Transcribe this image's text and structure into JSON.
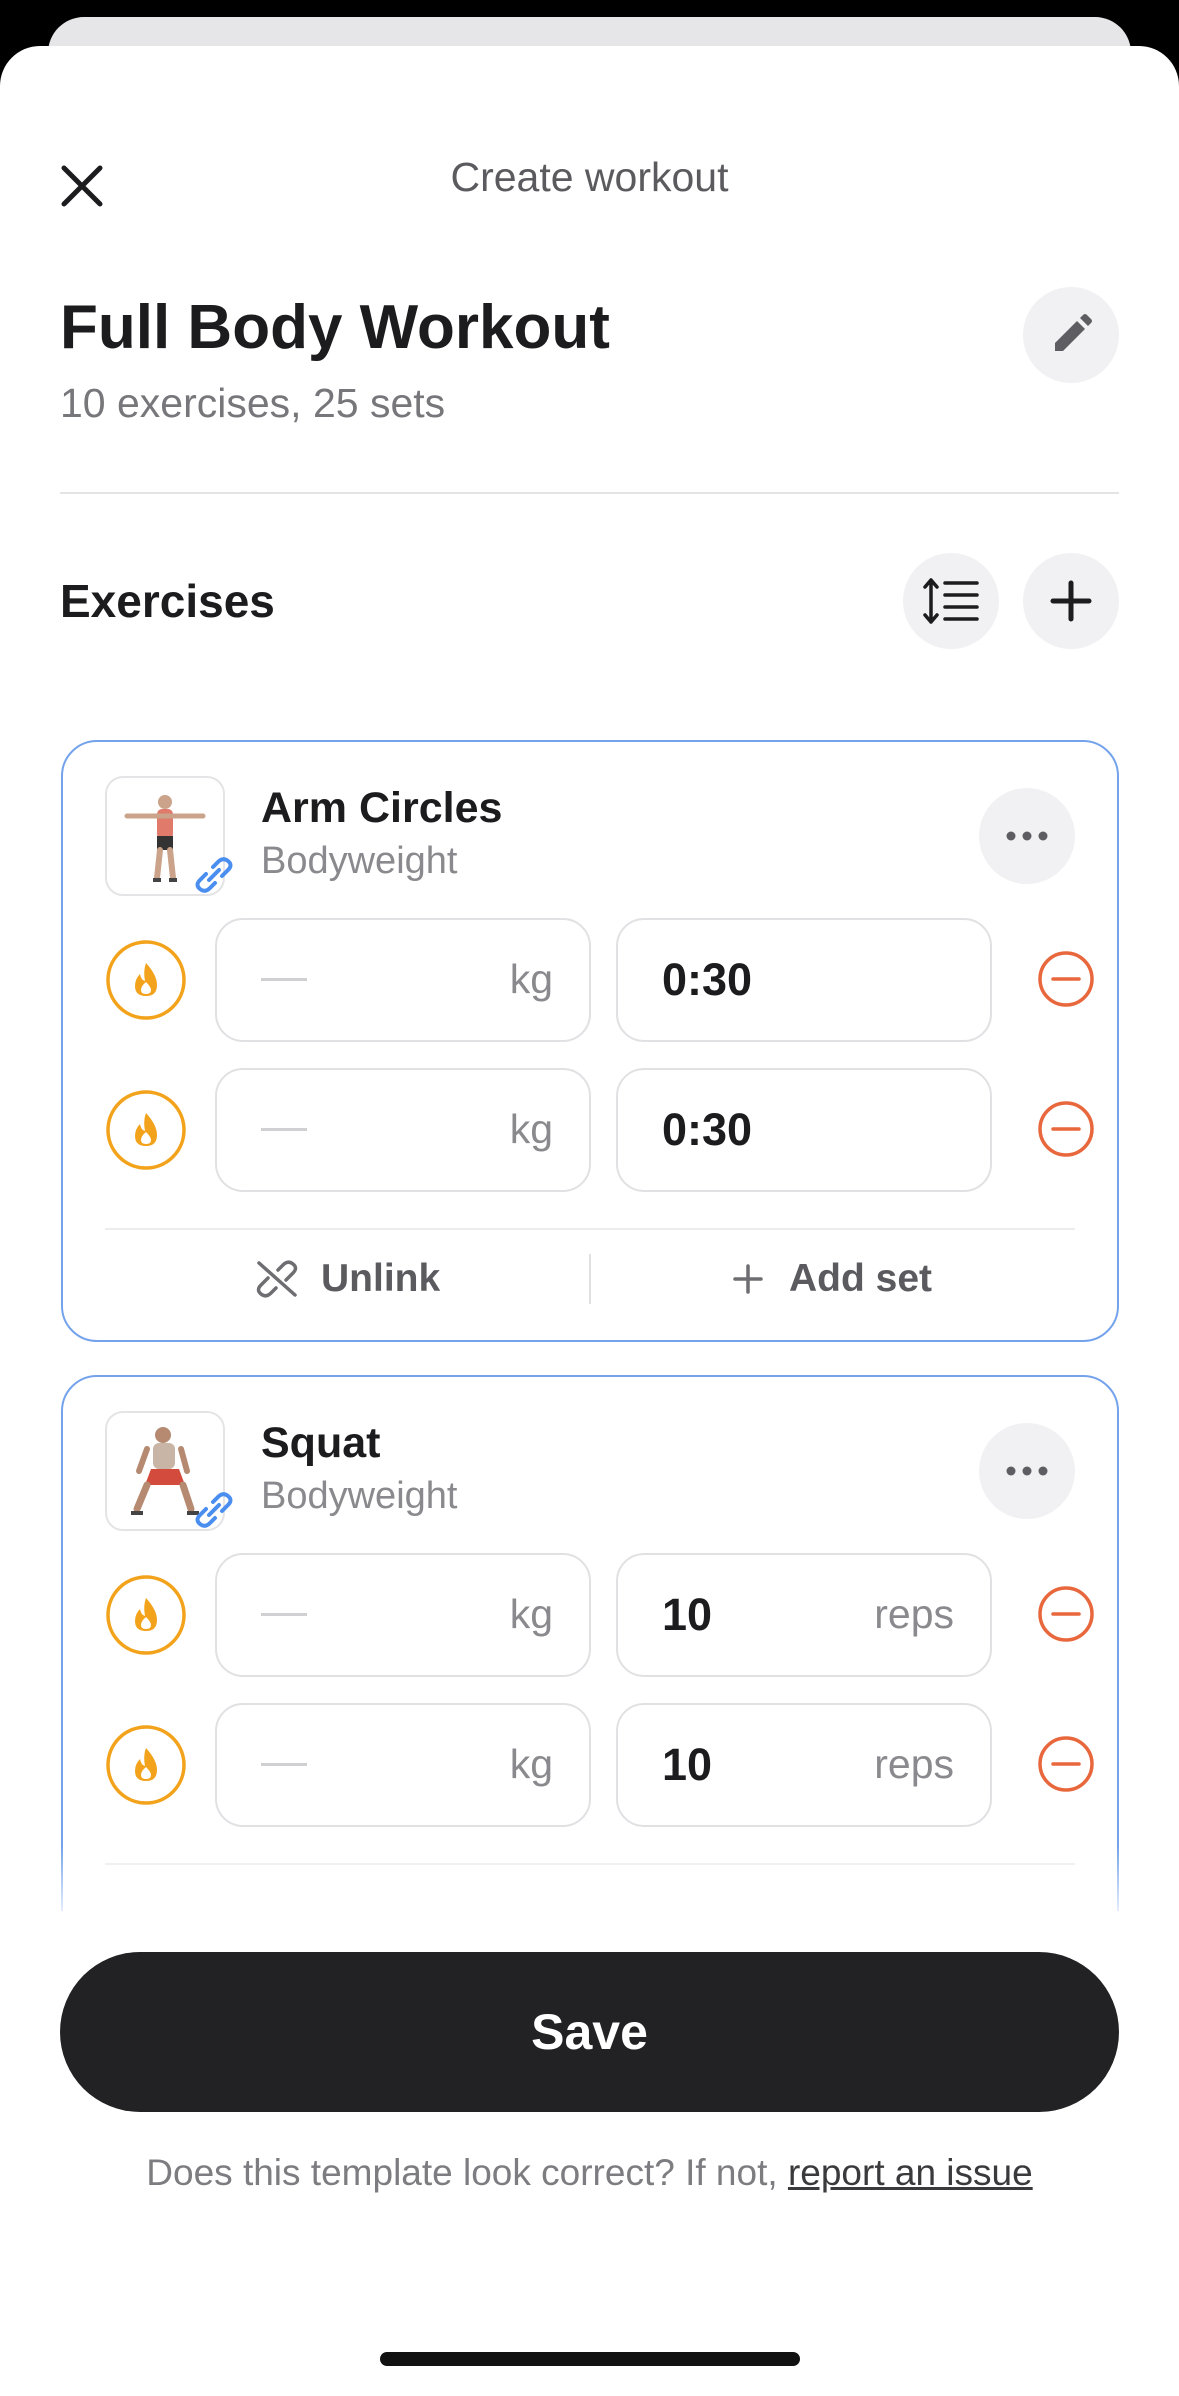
{
  "header": {
    "title": "Create workout"
  },
  "workout": {
    "name": "Full Body Workout",
    "summary": "10 exercises, 25 sets"
  },
  "exercises_section": {
    "title": "Exercises"
  },
  "exercises": [
    {
      "name": "Arm Circles",
      "equipment": "Bodyweight",
      "sets": [
        {
          "weight_unit": "kg",
          "value": "0:30",
          "value_unit": ""
        },
        {
          "weight_unit": "kg",
          "value": "0:30",
          "value_unit": ""
        }
      ],
      "unlink_label": "Unlink",
      "add_set_label": "Add set"
    },
    {
      "name": "Squat",
      "equipment": "Bodyweight",
      "sets": [
        {
          "weight_unit": "kg",
          "value": "10",
          "value_unit": "reps"
        },
        {
          "weight_unit": "kg",
          "value": "10",
          "value_unit": "reps"
        }
      ]
    }
  ],
  "footer": {
    "save_label": "Save",
    "report_prompt": "Does this template look correct? If not,",
    "report_link": "report an issue"
  },
  "colors": {
    "accent_border": "#74a3ec",
    "warmup_orange": "#f2a31b",
    "remove_red": "#e8673c",
    "save_bg": "#222224",
    "link_blue": "#4a8ef0"
  },
  "icons": {
    "close": "close-icon",
    "edit": "pencil-icon",
    "reorder": "reorder-icon",
    "add": "plus-icon",
    "more": "more-horizontal-icon",
    "warmup": "flame-icon",
    "remove": "minus-circle-icon",
    "unlink": "unlink-icon",
    "link": "link-icon"
  }
}
